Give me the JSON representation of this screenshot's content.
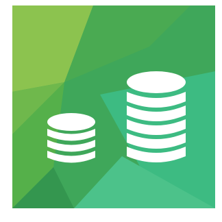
{
  "icon": {
    "name": "coin-stacks-icon",
    "colors": {
      "base": "#3fa75a",
      "light": "#8cc34f",
      "mid": "#62b447",
      "teal": "#3dbb82",
      "dark": "#34964f",
      "coin": "#ffffff"
    }
  }
}
